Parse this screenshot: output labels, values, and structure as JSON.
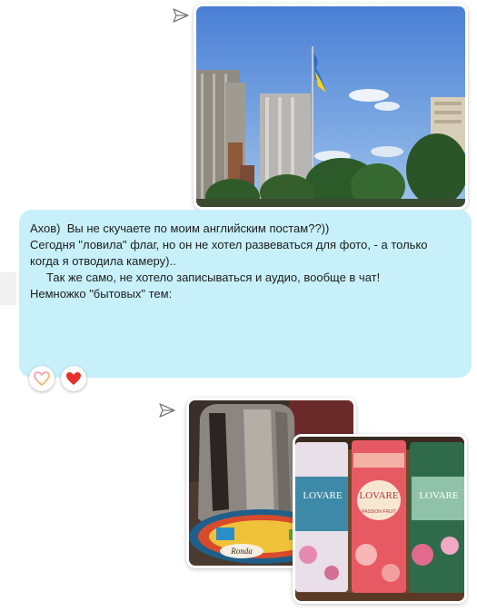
{
  "message": {
    "lines": [
      "Ахов)  Вы не скучаете по моим английским постам??))",
      "",
      "Сегодня \"ловила\" флаг, но он не хотел развеваться для фото, - а только",
      "когда я отводила камеру)..",
      "     Так же само, не хотело записываться и аудио, вообще в чат!",
      "",
      "Немножко \"бытовых\" тем:"
    ]
  },
  "reactions": [
    {
      "icon": "heart-outline-gradient-icon"
    },
    {
      "icon": "red-heart-icon",
      "color": "#e8302a"
    }
  ],
  "photos": {
    "flag_photo": {
      "description": "city-flag-photo"
    },
    "kettle_photo": {
      "description": "kettle-photo",
      "printed_text": "Ronda"
    },
    "tea_photo": {
      "description": "tea-tins-photo",
      "printed_text": [
        "LOVARE",
        "LOVARE",
        "LOVARE",
        "PASSION FRUIT"
      ]
    }
  },
  "colors": {
    "bubble_bg": "#c7f0fa",
    "heart": "#e8302a"
  }
}
